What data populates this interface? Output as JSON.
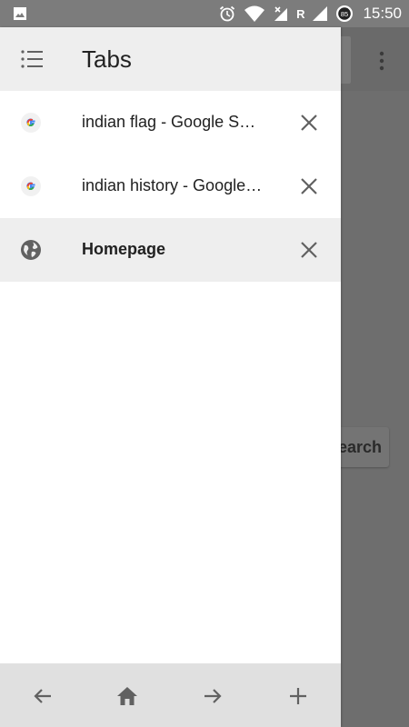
{
  "status_bar": {
    "time": "15:50",
    "network_label": "R",
    "battery_level": "85",
    "icons": [
      "image-icon",
      "alarm-icon",
      "wifi-icon",
      "signal-icon",
      "battery-icon"
    ]
  },
  "background": {
    "search_button_label": "Search"
  },
  "drawer": {
    "title": "Tabs",
    "tabs": [
      {
        "title": "indian flag - Google Search",
        "favicon": "google-icon",
        "active": false
      },
      {
        "title": "indian history - Google Search",
        "favicon": "google-icon",
        "active": false
      },
      {
        "title": "Homepage",
        "favicon": "globe-icon",
        "active": true
      }
    ]
  },
  "bottom_bar": {
    "buttons": [
      "back-arrow-icon",
      "home-icon",
      "forward-arrow-icon",
      "add-icon"
    ]
  },
  "colors": {
    "header_bg": "#eeeeee",
    "active_tab_bg": "#eeeeee",
    "bottom_bar_bg": "#e0e0e0",
    "scrim": "#6b6b6b",
    "icon_gray": "#616161"
  }
}
